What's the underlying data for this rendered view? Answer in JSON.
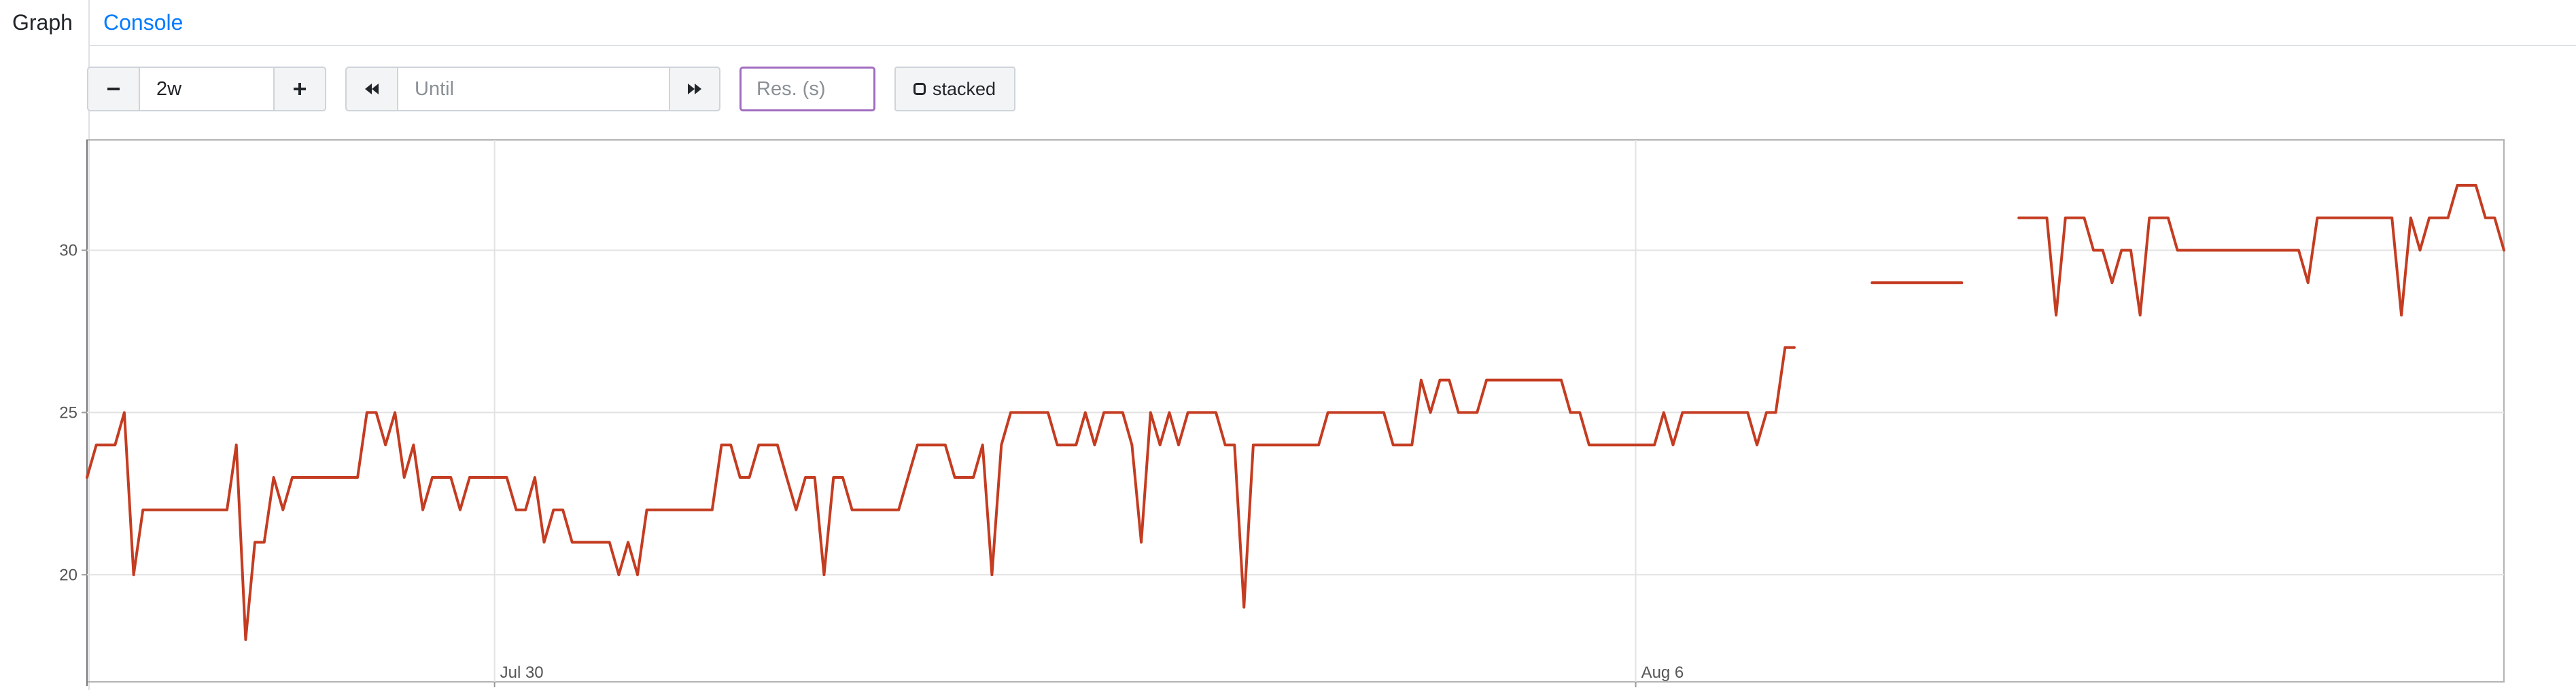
{
  "tabs": [
    {
      "label": "Graph",
      "active": true
    },
    {
      "label": "Console",
      "active": false
    }
  ],
  "controls": {
    "range_minus_icon": "minus-icon",
    "range_value": "2w",
    "range_plus_icon": "plus-icon",
    "back_icon": "fast-backward-icon",
    "until_placeholder": "Until",
    "forward_icon": "fast-forward-icon",
    "resolution_placeholder": "Res. (s)",
    "stacked_label": "stacked",
    "stacked_checked": false
  },
  "colors": {
    "series": "#c43c21",
    "link": "#007bff",
    "focus": "#a06cc0"
  },
  "chart_data": {
    "type": "line",
    "xlim": [
      0,
      14
    ],
    "ylim": [
      16.7,
      33.4
    ],
    "x_ticks": [
      {
        "x": 2.5,
        "label": "Jul 30"
      },
      {
        "x": 9.5,
        "label": "Aug 6"
      }
    ],
    "y_ticks": [
      20,
      25,
      30
    ],
    "grid": true,
    "legend": "none",
    "series": [
      {
        "values": [
          [
            0.0,
            23
          ],
          [
            0.057,
            24
          ],
          [
            0.172,
            24
          ],
          [
            0.229,
            25
          ],
          [
            0.286,
            20
          ],
          [
            0.343,
            22
          ],
          [
            0.401,
            22
          ],
          [
            0.458,
            22
          ],
          [
            0.515,
            22
          ],
          [
            0.572,
            22
          ],
          [
            0.63,
            22
          ],
          [
            0.687,
            22
          ],
          [
            0.744,
            22
          ],
          [
            0.801,
            22
          ],
          [
            0.859,
            22
          ],
          [
            0.916,
            24
          ],
          [
            0.973,
            18
          ],
          [
            1.03,
            21
          ],
          [
            1.087,
            21
          ],
          [
            1.145,
            23
          ],
          [
            1.202,
            22
          ],
          [
            1.259,
            23
          ],
          [
            1.316,
            23
          ],
          [
            1.374,
            23
          ],
          [
            1.431,
            23
          ],
          [
            1.488,
            23
          ],
          [
            1.545,
            23
          ],
          [
            1.603,
            23
          ],
          [
            1.66,
            23
          ],
          [
            1.717,
            25
          ],
          [
            1.774,
            25
          ],
          [
            1.831,
            24
          ],
          [
            1.889,
            25
          ],
          [
            1.946,
            23
          ],
          [
            2.003,
            24
          ],
          [
            2.06,
            22
          ],
          [
            2.118,
            23
          ],
          [
            2.175,
            23
          ],
          [
            2.232,
            23
          ],
          [
            2.289,
            22
          ],
          [
            2.347,
            23
          ],
          [
            2.404,
            23
          ],
          [
            2.461,
            23
          ],
          [
            2.518,
            23
          ],
          [
            2.575,
            23
          ],
          [
            2.633,
            22
          ],
          [
            2.69,
            22
          ],
          [
            2.747,
            23
          ],
          [
            2.804,
            21
          ],
          [
            2.862,
            22
          ],
          [
            2.919,
            22
          ],
          [
            2.976,
            21
          ],
          [
            3.033,
            21
          ],
          [
            3.091,
            21
          ],
          [
            3.148,
            21
          ],
          [
            3.205,
            21
          ],
          [
            3.262,
            20
          ],
          [
            3.319,
            21
          ],
          [
            3.377,
            20
          ],
          [
            3.434,
            22
          ],
          [
            3.491,
            22
          ],
          [
            3.548,
            22
          ],
          [
            3.606,
            22
          ],
          [
            3.663,
            22
          ],
          [
            3.72,
            22
          ],
          [
            3.777,
            22
          ],
          [
            3.835,
            22
          ],
          [
            3.892,
            24
          ],
          [
            3.949,
            24
          ],
          [
            4.006,
            23
          ],
          [
            4.063,
            23
          ],
          [
            4.121,
            24
          ],
          [
            4.178,
            24
          ],
          [
            4.235,
            24
          ],
          [
            4.292,
            23
          ],
          [
            4.35,
            22
          ],
          [
            4.407,
            23
          ],
          [
            4.464,
            23
          ],
          [
            4.521,
            20
          ],
          [
            4.579,
            23
          ],
          [
            4.636,
            23
          ],
          [
            4.693,
            22
          ],
          [
            4.75,
            22
          ],
          [
            4.807,
            22
          ],
          [
            4.865,
            22
          ],
          [
            4.922,
            22
          ],
          [
            4.979,
            22
          ],
          [
            5.036,
            23
          ],
          [
            5.094,
            24
          ],
          [
            5.151,
            24
          ],
          [
            5.208,
            24
          ],
          [
            5.265,
            24
          ],
          [
            5.323,
            23
          ],
          [
            5.38,
            23
          ],
          [
            5.437,
            23
          ],
          [
            5.494,
            24
          ],
          [
            5.551,
            20
          ],
          [
            5.609,
            24
          ],
          [
            5.666,
            25
          ],
          [
            5.723,
            25
          ],
          [
            5.78,
            25
          ],
          [
            5.838,
            25
          ],
          [
            5.895,
            25
          ],
          [
            5.952,
            24
          ],
          [
            6.009,
            24
          ],
          [
            6.067,
            24
          ],
          [
            6.124,
            25
          ],
          [
            6.181,
            24
          ],
          [
            6.238,
            25
          ],
          [
            6.295,
            25
          ],
          [
            6.353,
            25
          ],
          [
            6.41,
            24
          ],
          [
            6.467,
            21
          ],
          [
            6.524,
            25
          ],
          [
            6.582,
            24
          ],
          [
            6.639,
            25
          ],
          [
            6.696,
            24
          ],
          [
            6.753,
            25
          ],
          [
            6.811,
            25
          ],
          [
            6.868,
            25
          ],
          [
            6.925,
            25
          ],
          [
            6.982,
            24
          ],
          [
            7.039,
            24
          ],
          [
            7.097,
            19
          ],
          [
            7.154,
            24
          ],
          [
            7.211,
            24
          ],
          [
            7.268,
            24
          ],
          [
            7.326,
            24
          ],
          [
            7.383,
            24
          ],
          [
            7.44,
            24
          ],
          [
            7.497,
            24
          ],
          [
            7.555,
            24
          ],
          [
            7.612,
            25
          ],
          [
            7.669,
            25
          ],
          [
            7.726,
            25
          ],
          [
            7.783,
            25
          ],
          [
            7.841,
            25
          ],
          [
            7.898,
            25
          ],
          [
            7.955,
            25
          ],
          [
            8.012,
            24
          ],
          [
            8.07,
            24
          ],
          [
            8.127,
            24
          ],
          [
            8.184,
            26
          ],
          [
            8.241,
            25
          ],
          [
            8.299,
            26
          ],
          [
            8.356,
            26
          ],
          [
            8.413,
            25
          ],
          [
            8.47,
            25
          ],
          [
            8.527,
            25
          ],
          [
            8.585,
            26
          ],
          [
            8.642,
            26
          ],
          [
            8.699,
            26
          ],
          [
            8.756,
            26
          ],
          [
            8.814,
            26
          ],
          [
            8.871,
            26
          ],
          [
            8.928,
            26
          ],
          [
            8.985,
            26
          ],
          [
            9.043,
            26
          ],
          [
            9.1,
            25
          ],
          [
            9.157,
            25
          ],
          [
            9.214,
            24
          ],
          [
            9.271,
            24
          ],
          [
            9.329,
            24
          ],
          [
            9.386,
            24
          ],
          [
            9.443,
            24
          ],
          [
            9.5,
            24
          ],
          [
            9.558,
            24
          ],
          [
            9.615,
            24
          ],
          [
            9.672,
            25
          ],
          [
            9.729,
            24
          ],
          [
            9.787,
            25
          ],
          [
            9.844,
            25
          ],
          [
            9.901,
            25
          ],
          [
            9.958,
            25
          ],
          [
            10.015,
            25
          ],
          [
            10.073,
            25
          ],
          [
            10.13,
            25
          ],
          [
            10.187,
            25
          ],
          [
            10.244,
            24
          ],
          [
            10.302,
            25
          ],
          [
            10.359,
            25
          ],
          [
            10.416,
            27
          ],
          [
            10.473,
            27
          ]
        ]
      },
      {
        "values": [
          [
            10.95,
            29
          ],
          [
            11.5,
            29
          ]
        ]
      },
      {
        "values": [
          [
            11.85,
            31
          ],
          [
            11.907,
            31
          ],
          [
            11.965,
            31
          ],
          [
            12.022,
            31
          ],
          [
            12.079,
            28
          ],
          [
            12.136,
            31
          ],
          [
            12.193,
            31
          ],
          [
            12.251,
            31
          ],
          [
            12.308,
            30
          ],
          [
            12.365,
            30
          ],
          [
            12.422,
            29
          ],
          [
            12.48,
            30
          ],
          [
            12.537,
            30
          ],
          [
            12.594,
            28
          ],
          [
            12.651,
            31
          ],
          [
            12.709,
            31
          ],
          [
            12.766,
            31
          ],
          [
            12.823,
            30
          ],
          [
            12.88,
            30
          ],
          [
            12.937,
            30
          ],
          [
            12.995,
            30
          ],
          [
            13.052,
            30
          ],
          [
            13.109,
            30
          ],
          [
            13.166,
            30
          ],
          [
            13.224,
            30
          ],
          [
            13.281,
            30
          ],
          [
            13.338,
            30
          ],
          [
            13.395,
            30
          ],
          [
            13.453,
            30
          ],
          [
            13.51,
            30
          ],
          [
            13.567,
            30
          ],
          [
            13.624,
            29
          ],
          [
            13.681,
            31
          ],
          [
            13.739,
            31
          ],
          [
            13.796,
            31
          ],
          [
            13.853,
            31
          ],
          [
            13.91,
            31
          ],
          [
            13.968,
            31
          ],
          [
            14.025,
            31
          ],
          [
            14.082,
            31
          ],
          [
            14.139,
            31
          ],
          [
            14.197,
            28
          ],
          [
            14.254,
            31
          ],
          [
            14.311,
            30
          ],
          [
            14.368,
            31
          ],
          [
            14.425,
            31
          ],
          [
            14.483,
            31
          ],
          [
            14.54,
            32
          ],
          [
            14.597,
            32
          ],
          [
            14.654,
            32
          ],
          [
            14.712,
            31
          ],
          [
            14.769,
            31
          ],
          [
            14.826,
            30
          ]
        ]
      }
    ]
  }
}
